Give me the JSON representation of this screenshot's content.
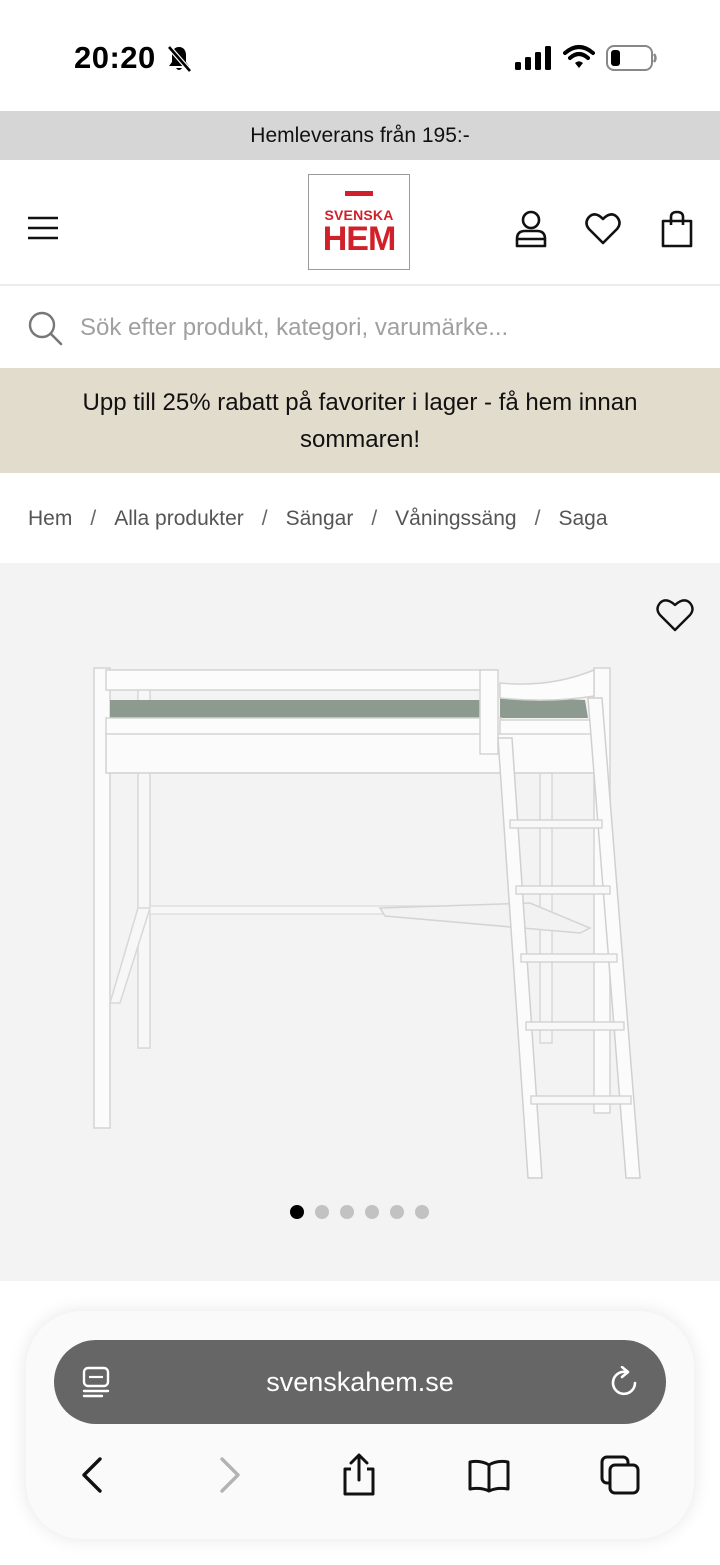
{
  "status_bar": {
    "time": "20:20",
    "icons": [
      "bell-slash-icon",
      "cellular-signal-icon",
      "wifi-icon",
      "battery-icon"
    ]
  },
  "delivery_banner": {
    "text": "Hemleverans från 195:-"
  },
  "header": {
    "logo_top": "SVENSKA",
    "logo_bottom": "HEM",
    "icons": [
      "menu-icon",
      "user-icon",
      "heart-icon",
      "shopping-bag-icon"
    ],
    "brand_color": "#d0202a"
  },
  "search": {
    "placeholder": "Sök efter produkt, kategori, varumärke..."
  },
  "promo": {
    "text": "Upp till 25% rabatt på favoriter i lager - få hem innan sommaren!",
    "background": "#e2dccd"
  },
  "breadcrumb": {
    "items": [
      "Hem",
      "Alla produkter",
      "Sängar",
      "Våningssäng",
      "Saga"
    ],
    "separator": "/"
  },
  "gallery": {
    "image_count": 6,
    "active_index": 0
  },
  "browser": {
    "url": "svenskahem.se",
    "toolbar": [
      "back-icon",
      "forward-icon",
      "share-icon",
      "bookmarks-icon",
      "tabs-icon"
    ]
  }
}
